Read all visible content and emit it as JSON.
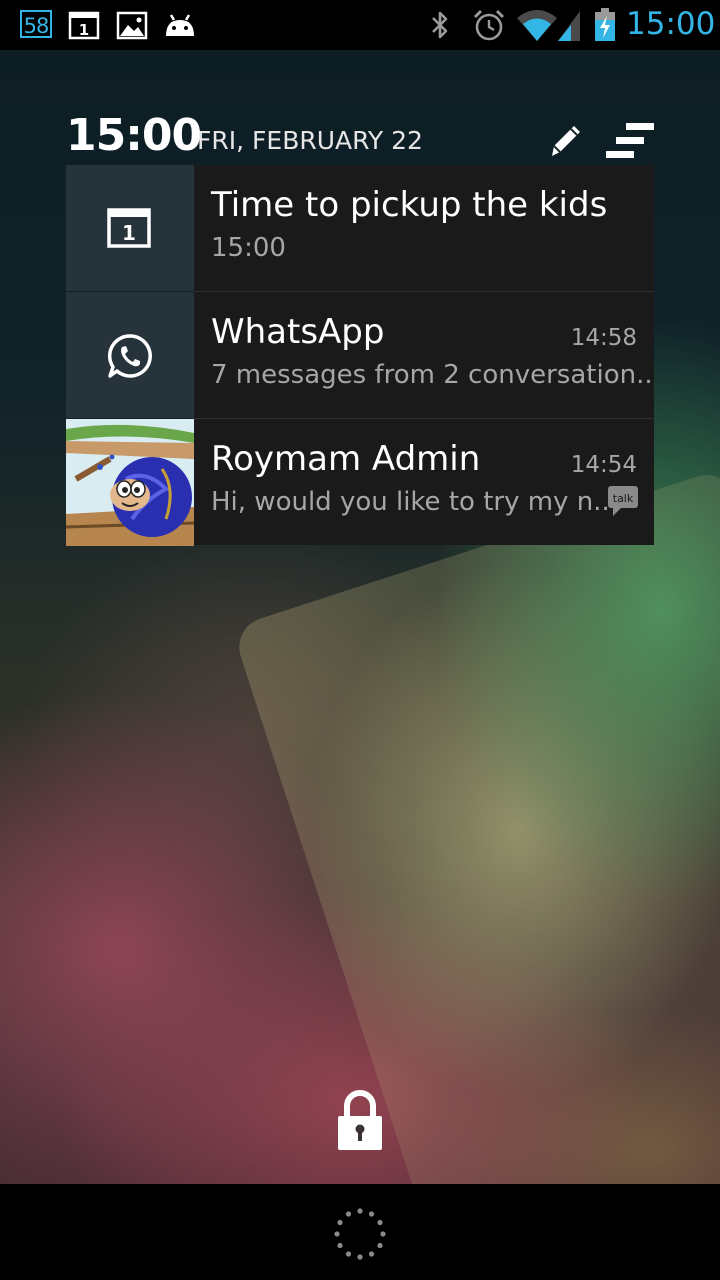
{
  "status_bar": {
    "notification_count": "58",
    "time": "15:00",
    "icons": [
      "calendar-icon",
      "image-icon",
      "android-icon",
      "bluetooth-icon",
      "alarm-icon",
      "wifi-icon",
      "signal-icon",
      "battery-charging-icon"
    ]
  },
  "header": {
    "clock": "15:00",
    "date": "FRI, FEBRUARY 22"
  },
  "calendar_day": "1",
  "notifications": [
    {
      "app_icon": "calendar-icon",
      "title": "Time to pickup the kids",
      "subtitle": "15:00",
      "time": ""
    },
    {
      "app_icon": "whatsapp-icon",
      "title": "WhatsApp",
      "subtitle": "7 messages from 2 conversation..",
      "time": "14:58"
    },
    {
      "app_icon": "avatar",
      "title": "Roymam Admin",
      "subtitle": "Hi, would you like to try my n..",
      "time": "14:54",
      "badge_icon": "talk-icon",
      "badge_text": "talk"
    }
  ],
  "colors": {
    "accent": "#33b5e5",
    "notification_bg": "#1a1a1a",
    "icon_bg": "#26333b"
  }
}
